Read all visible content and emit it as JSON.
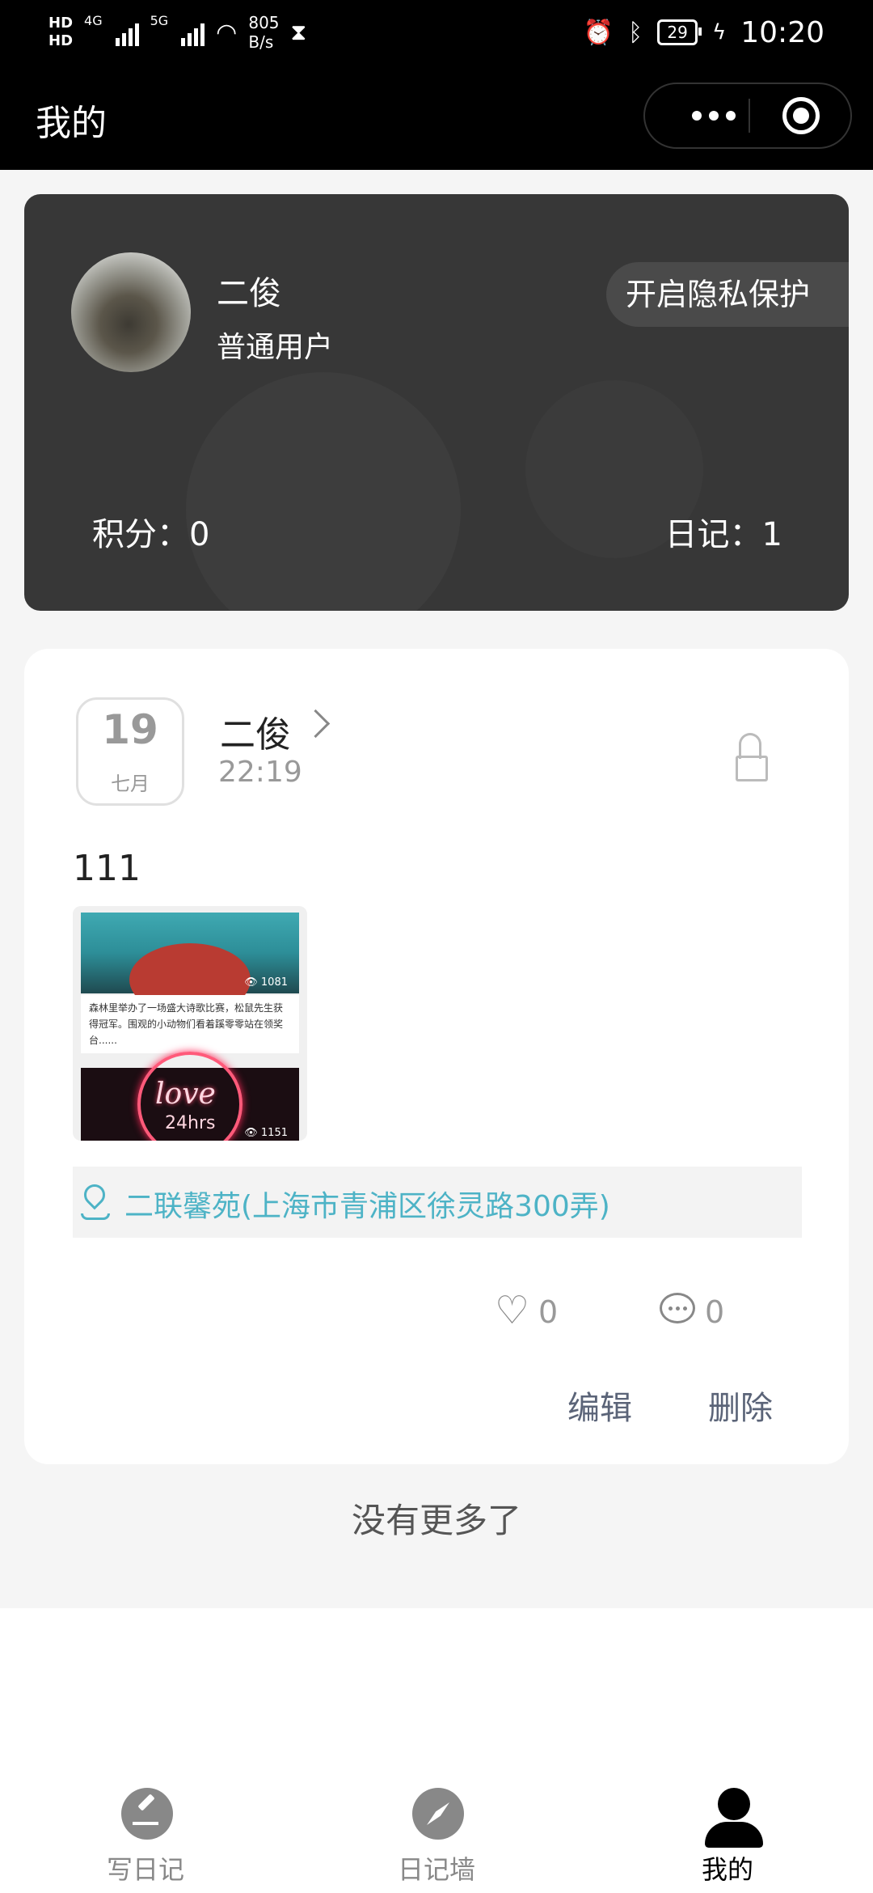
{
  "status_bar": {
    "hd1": "HD",
    "hd2": "HD",
    "net1": "4G",
    "net2": "5G",
    "speed_value": "805",
    "speed_unit": "B/s",
    "battery": "29",
    "time": "10:20"
  },
  "header": {
    "title": "我的"
  },
  "profile": {
    "name": "二俊",
    "role": "普通用户",
    "privacy_button": "开启隐私保护",
    "points_label": "积分：0",
    "diary_label": "日记：1"
  },
  "entry": {
    "day": "19",
    "month": "七月",
    "author": "二俊",
    "time": "22:19",
    "content": "111",
    "thumbnail": {
      "views_1": "1081",
      "text_1": "森林里举办了一场盛大诗歌比赛，松鼠先生获得冠军。围观的小动物们看着蹊零零站在领奖台......",
      "neon_word": "love",
      "neon_sub": "24hrs",
      "views_2": "1151"
    },
    "location": "二联馨苑(上海市青浦区徐灵路300弄)",
    "likes": "0",
    "comments": "0",
    "edit_label": "编辑",
    "delete_label": "删除"
  },
  "footer_text": "没有更多了",
  "tabs": [
    {
      "label": "写日记",
      "icon": "pen-icon"
    },
    {
      "label": "日记墙",
      "icon": "compass-icon"
    },
    {
      "label": "我的",
      "icon": "person-icon"
    }
  ],
  "colors": {
    "profile_card": "#373737",
    "accent_location": "#4db3c6",
    "action_text": "#5b6478"
  }
}
